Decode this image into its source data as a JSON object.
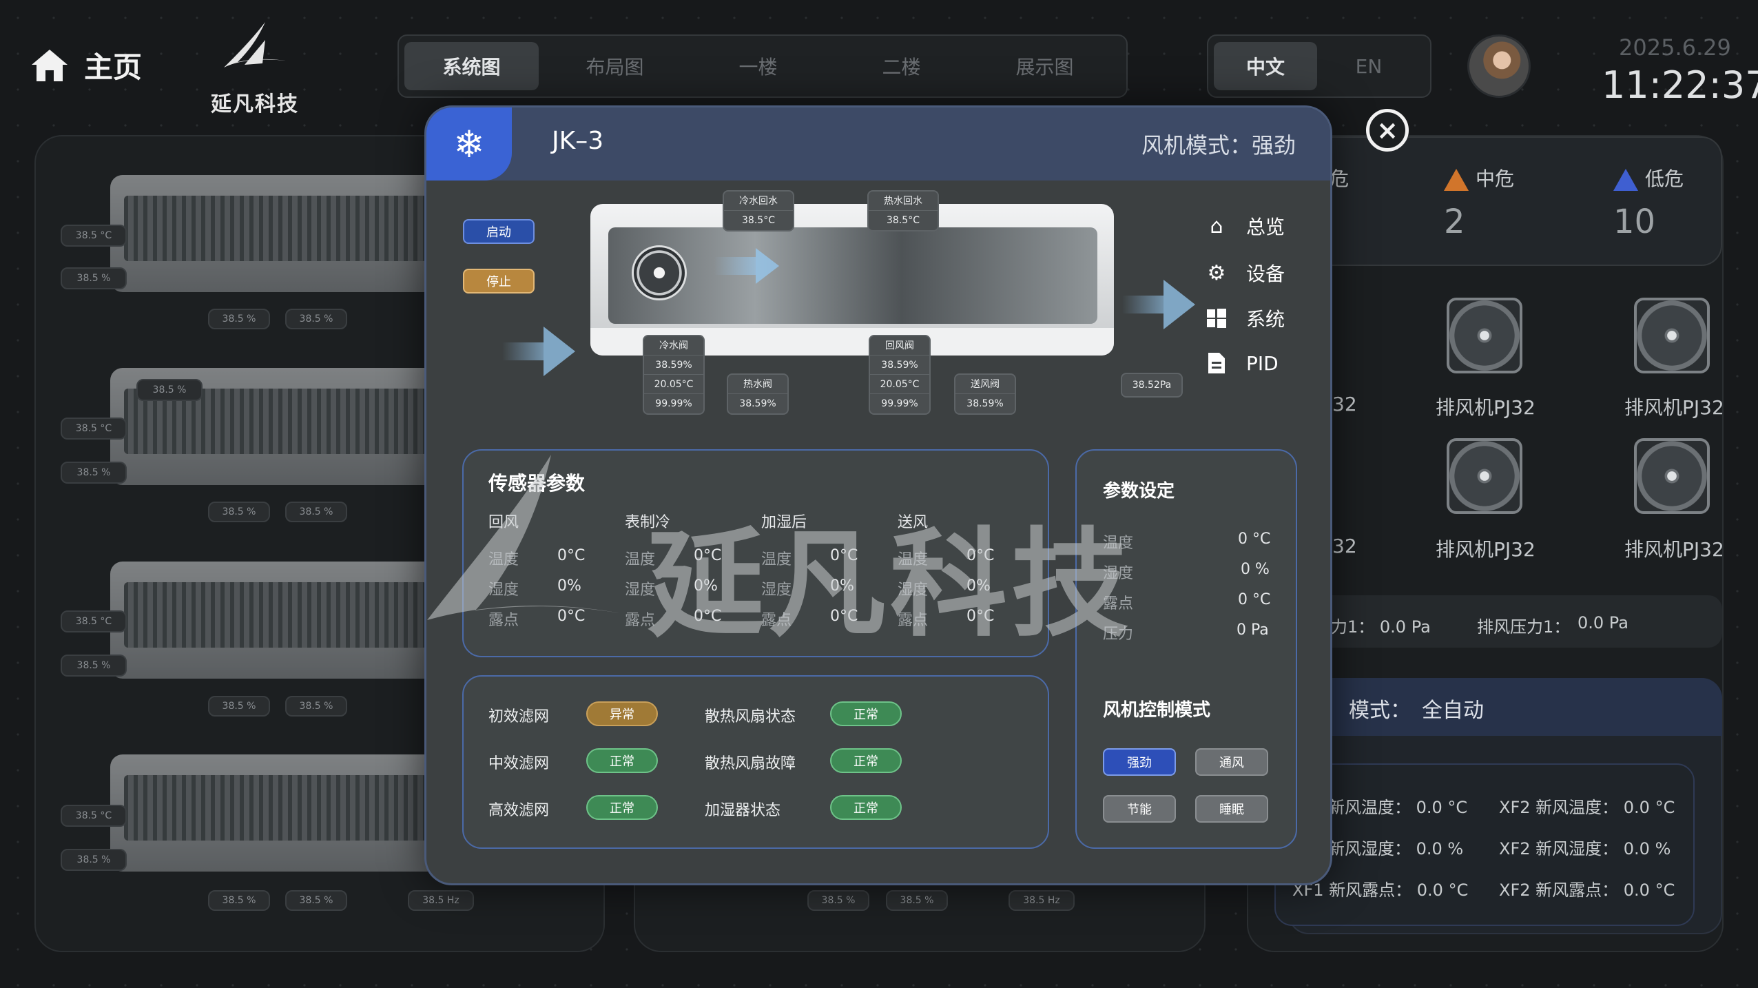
{
  "header": {
    "home_label": "主页",
    "brand": "延凡科技",
    "tabs": [
      "系统图",
      "布局图",
      "一楼",
      "二楼",
      "展示图"
    ],
    "lang": [
      "中文",
      "EN"
    ],
    "date": "2025.6.29",
    "time": "11:22:37"
  },
  "background": {
    "chip_temp": "38.5 °C",
    "chip_hum": "38.5 %",
    "chip_hz": "38.5 Hz",
    "risk": {
      "high_label": "危",
      "mid_label": "中危",
      "mid_count": "2",
      "low_label": "低危",
      "low_count": "10"
    },
    "fan_label": "排风机PJ32",
    "fan_label_partial": "32",
    "pressure": {
      "left": "力1： 0.0 Pa",
      "right_label": "排风压力1：",
      "right_value": "0.0 Pa"
    },
    "mode": {
      "label": "模式：",
      "value": "全自动"
    },
    "fresh": {
      "xf1_temp": "新风温度： 0.0 °C",
      "xf2_temp": "XF2 新风温度： 0.0 °C",
      "xf1_hum": "新风湿度： 0.0 %",
      "xf2_hum": "XF2 新风湿度： 0.0 %",
      "xf1_dew": "XF1 新风露点： 0.0 °C",
      "xf2_dew": "XF2 新风露点： 0.0 °C"
    }
  },
  "modal": {
    "title": "JK–3",
    "fan_mode_label": "风机模式：",
    "fan_mode_value": "强劲",
    "btn_start": "启动",
    "btn_stop": "停止",
    "tags": {
      "cold_return": {
        "name": "冷水回水",
        "value": "38.5°C"
      },
      "hot_return": {
        "name": "热水回水",
        "value": "38.5°C"
      },
      "cold_valve": {
        "name": "冷水阀",
        "v1": "38.59%",
        "v2": "20.05°C",
        "v3": "99.99%"
      },
      "hot_valve": {
        "name": "热水阀",
        "v1": "38.59%"
      },
      "return_valve": {
        "name": "回风阀",
        "v1": "38.59%",
        "v2": "20.05°C",
        "v3": "99.99%"
      },
      "supply_valve": {
        "name": "送风阀",
        "v1": "38.59%"
      },
      "pressure": "38.52Pa"
    },
    "sidenav": [
      "总览",
      "设备",
      "系统",
      "PID"
    ],
    "sensor": {
      "title": "传感器参数",
      "columns": [
        {
          "head": "回风",
          "temp": "0°C",
          "hum": "0%",
          "dew": "0°C"
        },
        {
          "head": "表制冷",
          "temp": "0°C",
          "hum": "0%",
          "dew": "0°C"
        },
        {
          "head": "加湿后",
          "temp": "0°C",
          "hum": "0%",
          "dew": "0°C"
        },
        {
          "head": "送风",
          "temp": "0°C",
          "hum": "0%",
          "dew": "0°C"
        }
      ],
      "labels": {
        "temp": "温度",
        "hum": "湿度",
        "dew": "露点"
      }
    },
    "params": {
      "title": "参数设定",
      "rows": [
        {
          "label": "温度",
          "value": "0 °C"
        },
        {
          "label": "湿度",
          "value": "0 %"
        },
        {
          "label": "露点",
          "value": "0 °C"
        },
        {
          "label": "压力",
          "value": "0 Pa"
        }
      ],
      "fan_title": "风机控制模式",
      "modes": [
        "强劲",
        "通风",
        "节能",
        "睡眠"
      ]
    },
    "status": [
      {
        "label": "初效滤网",
        "value": "异常",
        "state": "bad"
      },
      {
        "label": "中效滤网",
        "value": "正常",
        "state": "ok"
      },
      {
        "label": "高效滤网",
        "value": "正常",
        "state": "ok"
      },
      {
        "label": "散热风扇状态",
        "value": "正常",
        "state": "ok"
      },
      {
        "label": "散热风扇故障",
        "value": "正常",
        "state": "ok"
      },
      {
        "label": "加湿器状态",
        "value": "正常",
        "state": "ok"
      }
    ],
    "watermark": "延凡科技"
  }
}
